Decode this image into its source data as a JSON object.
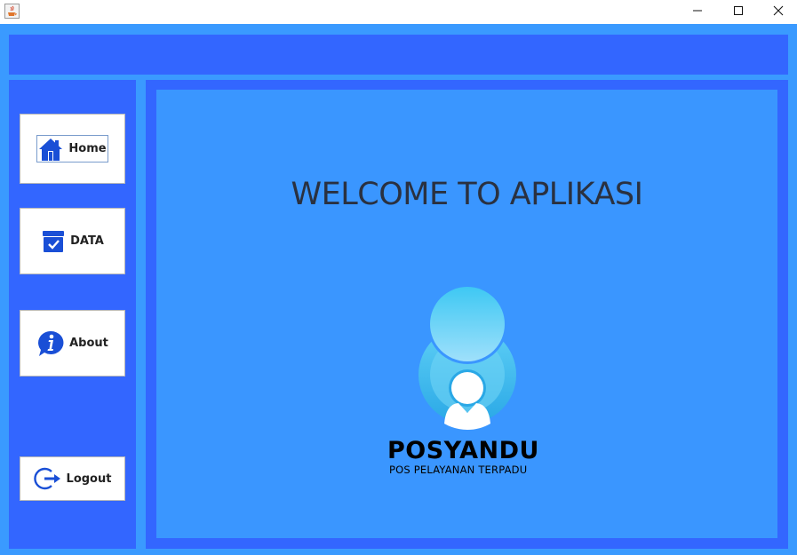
{
  "window": {
    "app_icon": "java-cup-icon",
    "controls": {
      "minimize": "minimize-icon",
      "maximize": "maximize-icon",
      "close": "close-icon"
    }
  },
  "sidebar": {
    "items": [
      {
        "label": "Home",
        "icon": "home-icon"
      },
      {
        "label": "DATA",
        "icon": "data-box-check-icon"
      },
      {
        "label": "About",
        "icon": "info-icon"
      },
      {
        "label": "Logout",
        "icon": "logout-icon"
      }
    ]
  },
  "main": {
    "welcome": "WELCOME TO APLIKASI",
    "logo": {
      "title": "POSYANDU",
      "subtitle": "POS PELAYANAN TERPADU"
    }
  },
  "colors": {
    "background": "#3a9aff",
    "panel": "#3366ff",
    "content": "#3a96ff",
    "icon_blue": "#1a4fd6"
  }
}
